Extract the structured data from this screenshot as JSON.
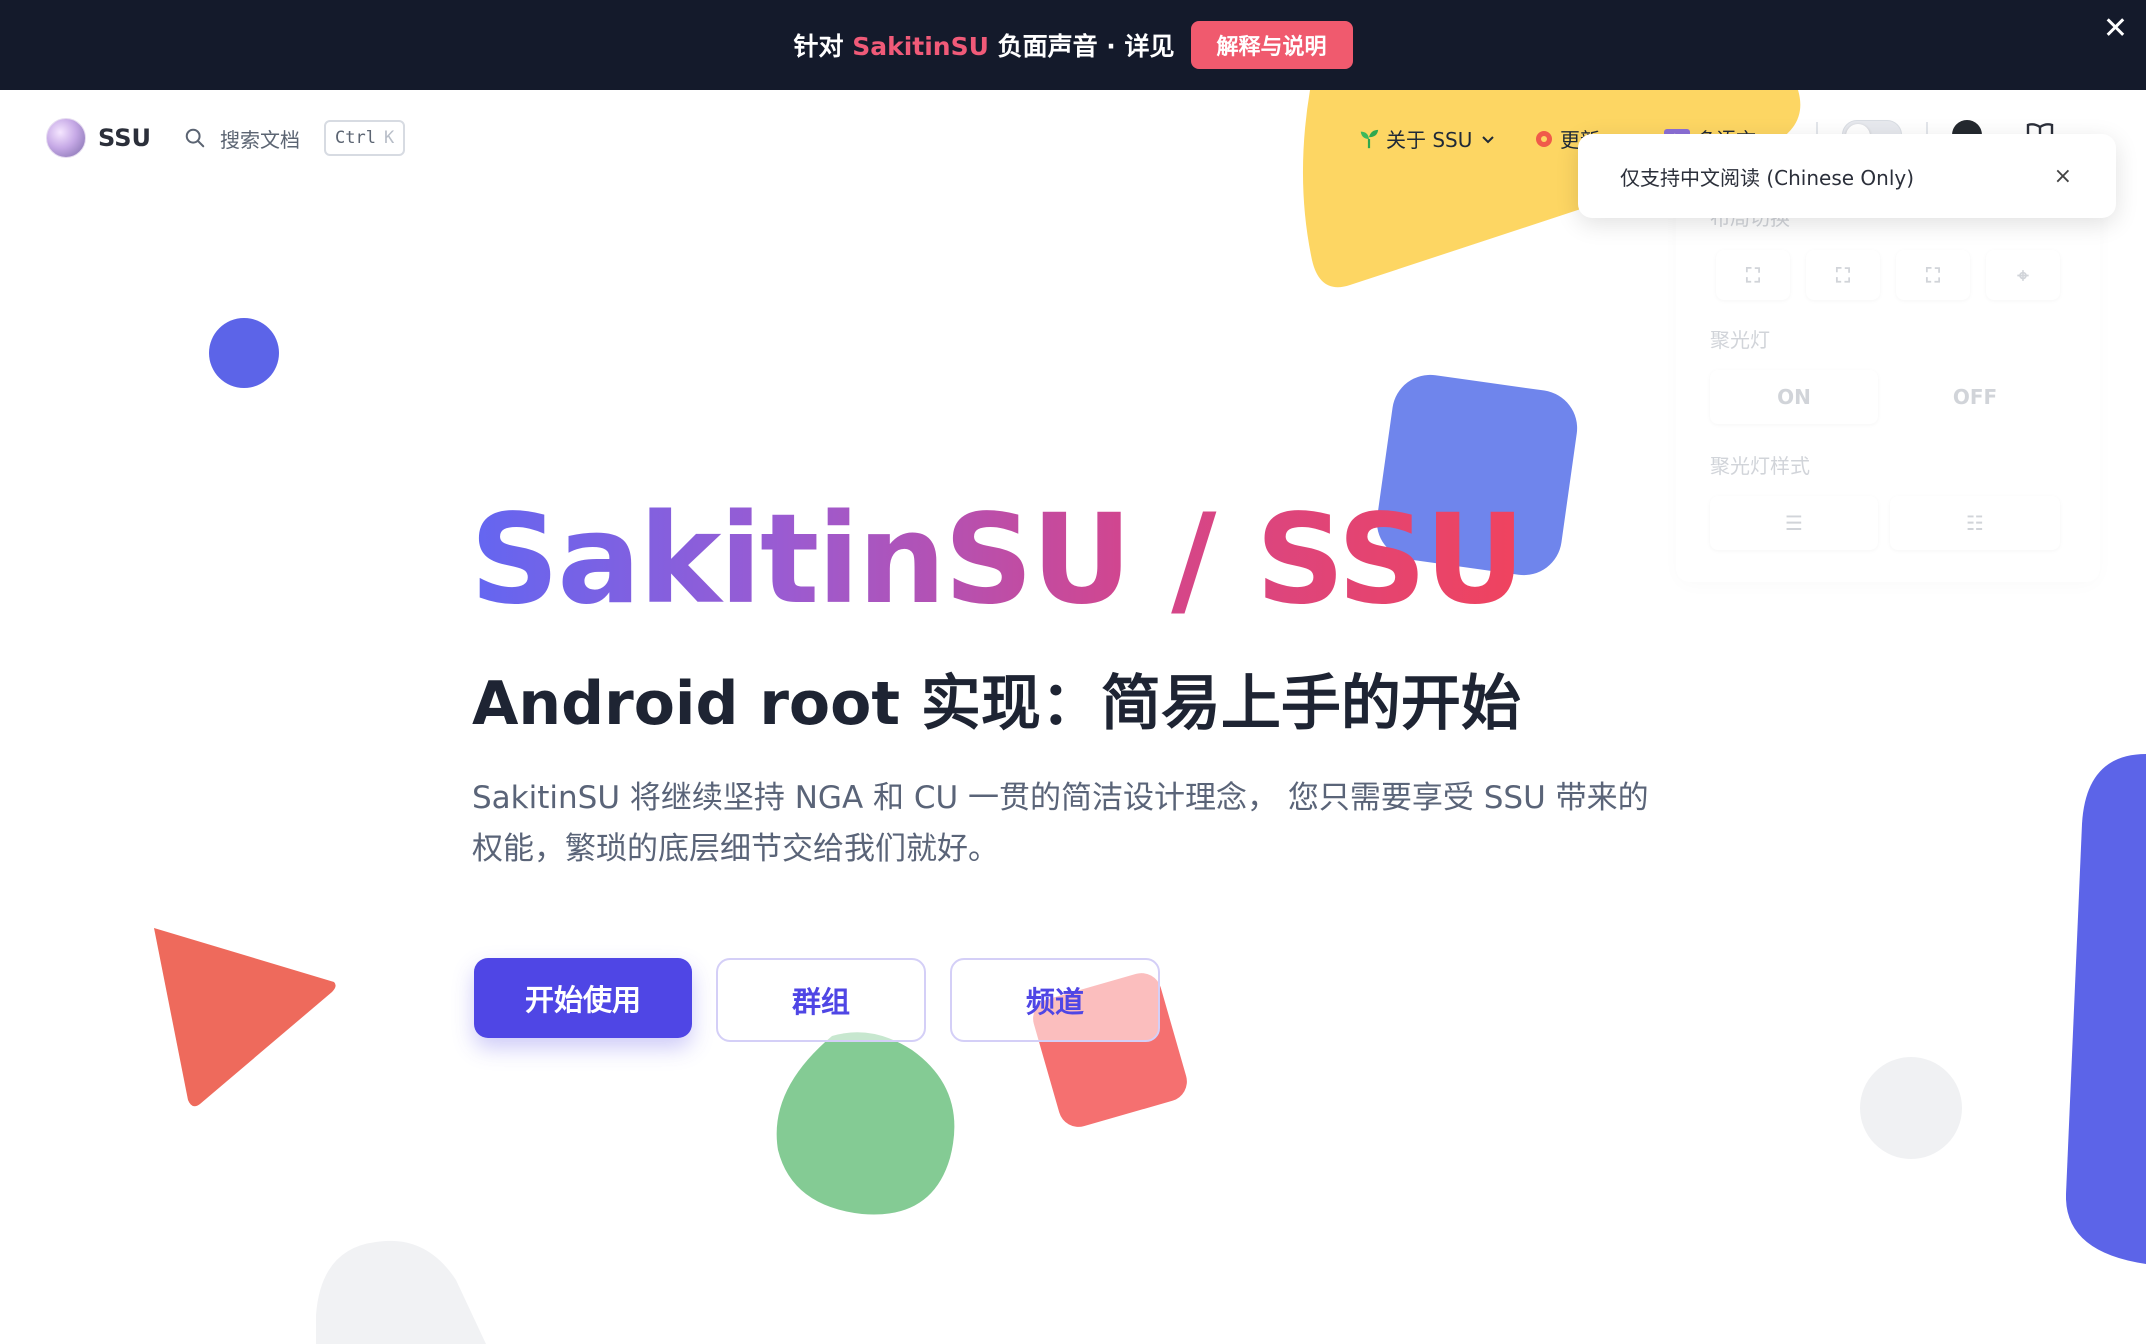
{
  "banner": {
    "prefix": "针对 ",
    "brand": "SakitinSU",
    "suffix": " 负面声音 · 详见",
    "button_label": "解释与说明",
    "close_label": "✕"
  },
  "nav": {
    "site_name": "SSU",
    "search_label": "搜索文档",
    "search_kbd_ctrl": "Ctrl",
    "search_kbd_key": "K",
    "items": [
      {
        "label": "关于 SSU",
        "icon": "sprout-icon"
      },
      {
        "label": "更新",
        "icon": "update-icon"
      },
      {
        "label": "多语言",
        "icon": "language-icon"
      }
    ]
  },
  "toast": {
    "text": "仅支持中文阅读 (Chinese Only)",
    "close_label": "×"
  },
  "layout_panel": {
    "title": "布局切换",
    "spotlight_label": "聚光灯",
    "spotlight_on": "ON",
    "spotlight_off": "OFF",
    "spotlight_style_label": "聚光灯样式"
  },
  "hero": {
    "title": "SakitinSU / SSU",
    "subtitle": "Android root 实现：简易上手的开始",
    "description": "SakitinSU 将继续坚持 NGA 和 CU 一贯的简洁设计理念， 您只需要享受 SSU 带来的权能，繁琐的底层细节交给我们就好。",
    "buttons": {
      "start": "开始使用",
      "group": "群组",
      "channel": "频道"
    }
  },
  "colors": {
    "banner_bg": "#141a2b",
    "brand_pink": "#f05a78",
    "primary": "#4f46e5",
    "title_gradient_start": "#6366f1",
    "title_gradient_end": "#f0435e"
  }
}
